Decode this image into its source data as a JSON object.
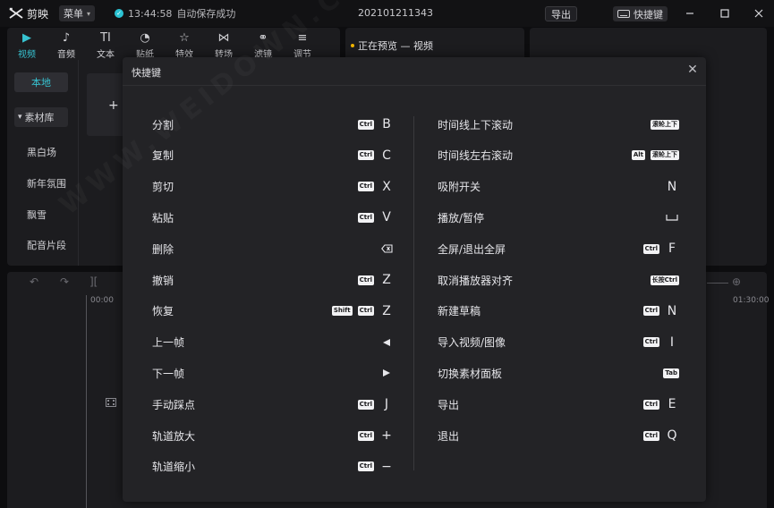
{
  "app": {
    "name": "剪映",
    "menu_label": "菜单",
    "save_time": "13:44:58",
    "save_status": "自动保存成功",
    "project_name": "202101211343",
    "export_label": "导出",
    "shortcut_label": "快捷键"
  },
  "toolbar": {
    "tabs": [
      {
        "label": "视频",
        "icon": "video-icon",
        "glyph": "▶"
      },
      {
        "label": "音频",
        "icon": "audio-icon",
        "glyph": "♪"
      },
      {
        "label": "文本",
        "icon": "text-icon",
        "glyph": "TI"
      },
      {
        "label": "贴纸",
        "icon": "sticker-icon",
        "glyph": "◔"
      },
      {
        "label": "特效",
        "icon": "effects-icon",
        "glyph": "☆"
      },
      {
        "label": "转场",
        "icon": "transition-icon",
        "glyph": "⋈"
      },
      {
        "label": "滤镜",
        "icon": "filter-icon",
        "glyph": "⚭"
      },
      {
        "label": "调节",
        "icon": "adjust-icon",
        "glyph": "≡"
      }
    ]
  },
  "preview": {
    "title": "正在预览 — 视频"
  },
  "sidebar": {
    "local_label": "本地",
    "library_label": "素材库",
    "library_arrow": "▾",
    "items": [
      "黑白场",
      "新年氛围",
      "飘雪",
      "配音片段"
    ]
  },
  "media": {
    "add_glyph": "+"
  },
  "timeline": {
    "time_start": "00:00",
    "time_end": "01:30:00"
  },
  "modal": {
    "title": "快捷键",
    "close_glyph": "✕",
    "left": [
      {
        "label": "分割",
        "keys": [
          {
            "badge": "Ctrl"
          },
          {
            "char": "B"
          }
        ]
      },
      {
        "label": "复制",
        "keys": [
          {
            "badge": "Ctrl"
          },
          {
            "char": "C"
          }
        ]
      },
      {
        "label": "剪切",
        "keys": [
          {
            "badge": "Ctrl"
          },
          {
            "char": "X"
          }
        ]
      },
      {
        "label": "粘贴",
        "keys": [
          {
            "badge": "Ctrl"
          },
          {
            "char": "V"
          }
        ]
      },
      {
        "label": "删除",
        "keys": [
          {
            "icon": "backspace-icon"
          }
        ]
      },
      {
        "label": "撤销",
        "keys": [
          {
            "badge": "Ctrl"
          },
          {
            "char": "Z"
          }
        ]
      },
      {
        "label": "恢复",
        "keys": [
          {
            "badge": "Shift"
          },
          {
            "badge": "Ctrl"
          },
          {
            "char": "Z"
          }
        ]
      },
      {
        "label": "上一帧",
        "keys": [
          {
            "icon": "arrow-left-icon"
          }
        ]
      },
      {
        "label": "下一帧",
        "keys": [
          {
            "icon": "arrow-right-icon"
          }
        ]
      },
      {
        "label": "手动踩点",
        "keys": [
          {
            "badge": "Ctrl"
          },
          {
            "char": "J"
          }
        ]
      },
      {
        "label": "轨道放大",
        "keys": [
          {
            "badge": "Ctrl"
          },
          {
            "char": "+"
          }
        ]
      },
      {
        "label": "轨道缩小",
        "keys": [
          {
            "badge": "Ctrl"
          },
          {
            "char": "−"
          }
        ]
      }
    ],
    "right": [
      {
        "label": "时间线上下滚动",
        "keys": [
          {
            "badge": "滚轮上下"
          }
        ]
      },
      {
        "label": "时间线左右滚动",
        "keys": [
          {
            "badge": "Alt"
          },
          {
            "badge": "滚轮上下"
          }
        ]
      },
      {
        "label": "吸附开关",
        "keys": [
          {
            "char": "N"
          }
        ]
      },
      {
        "label": "播放/暂停",
        "keys": [
          {
            "icon": "space-icon"
          }
        ]
      },
      {
        "label": "全屏/退出全屏",
        "keys": [
          {
            "badge": "Ctrl"
          },
          {
            "char": "F"
          }
        ]
      },
      {
        "label": "取消播放器对齐",
        "keys": [
          {
            "badge": "长按Ctrl"
          }
        ]
      },
      {
        "label": "新建草稿",
        "keys": [
          {
            "badge": "Ctrl"
          },
          {
            "char": "N"
          }
        ]
      },
      {
        "label": "导入视频/图像",
        "keys": [
          {
            "badge": "Ctrl"
          },
          {
            "char": "I"
          }
        ]
      },
      {
        "label": "切换素材面板",
        "keys": [
          {
            "badge": "Tab"
          }
        ]
      },
      {
        "label": "导出",
        "keys": [
          {
            "badge": "Ctrl"
          },
          {
            "char": "E"
          }
        ]
      },
      {
        "label": "退出",
        "keys": [
          {
            "badge": "Ctrl"
          },
          {
            "char": "Q"
          }
        ]
      }
    ]
  },
  "colors": {
    "accent": "#37c2d0",
    "background": "#0d0d0f",
    "panel": "#1c1c1f",
    "modal": "#232326"
  }
}
